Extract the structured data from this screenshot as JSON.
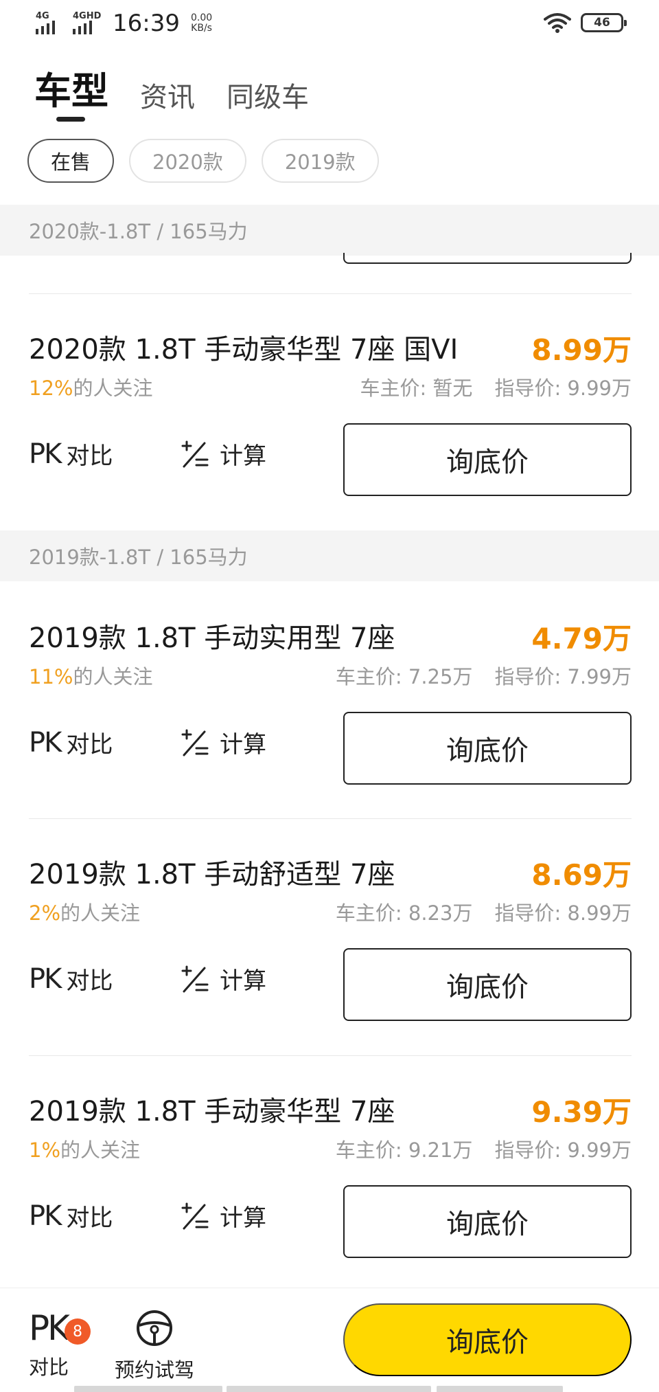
{
  "status_bar": {
    "signal1": "4G",
    "signal2": "4GHD",
    "time": "16:39",
    "speed_value": "0.00",
    "speed_unit": "KB/s",
    "battery": "46"
  },
  "tabs": [
    {
      "label": "车型"
    },
    {
      "label": "资讯"
    },
    {
      "label": "同级车"
    }
  ],
  "years": [
    {
      "label": "在售"
    },
    {
      "label": "2020款"
    },
    {
      "label": "2019款"
    }
  ],
  "sections": [
    {
      "header": "2020款-1.8T / 165马力"
    },
    {
      "header": "2019款-1.8T / 165马力"
    }
  ],
  "labels": {
    "pk": "PK",
    "compare": "对比",
    "calc": "计算",
    "inquiry": "询底价",
    "attention_suffix": "的人关注"
  },
  "items": [
    {
      "name": "2020款 1.8T 手动豪华型 7座 国VI",
      "price": "8.99万",
      "attention": "12%",
      "owner_price": "车主价: 暂无",
      "guide_price": "指导价: 9.99万"
    },
    {
      "name": "2019款 1.8T 手动实用型 7座",
      "price": "4.79万",
      "attention": "11%",
      "owner_price": "车主价: 7.25万",
      "guide_price": "指导价: 7.99万"
    },
    {
      "name": "2019款 1.8T 手动舒适型 7座",
      "price": "8.69万",
      "attention": "2%",
      "owner_price": "车主价: 8.23万",
      "guide_price": "指导价: 8.99万"
    },
    {
      "name": "2019款 1.8T 手动豪华型 7座",
      "price": "9.39万",
      "attention": "1%",
      "owner_price": "车主价: 9.21万",
      "guide_price": "指导价: 9.99万"
    }
  ],
  "bottom_bar": {
    "pk": "PK",
    "pk_badge": "8",
    "compare": "对比",
    "test_drive": "预约试驾",
    "inquiry": "询底价"
  },
  "colors": {
    "accent_orange": "#f08c00",
    "attention_orange": "#f0a020",
    "cta_yellow": "#ffd800",
    "badge_red": "#f05a28"
  }
}
